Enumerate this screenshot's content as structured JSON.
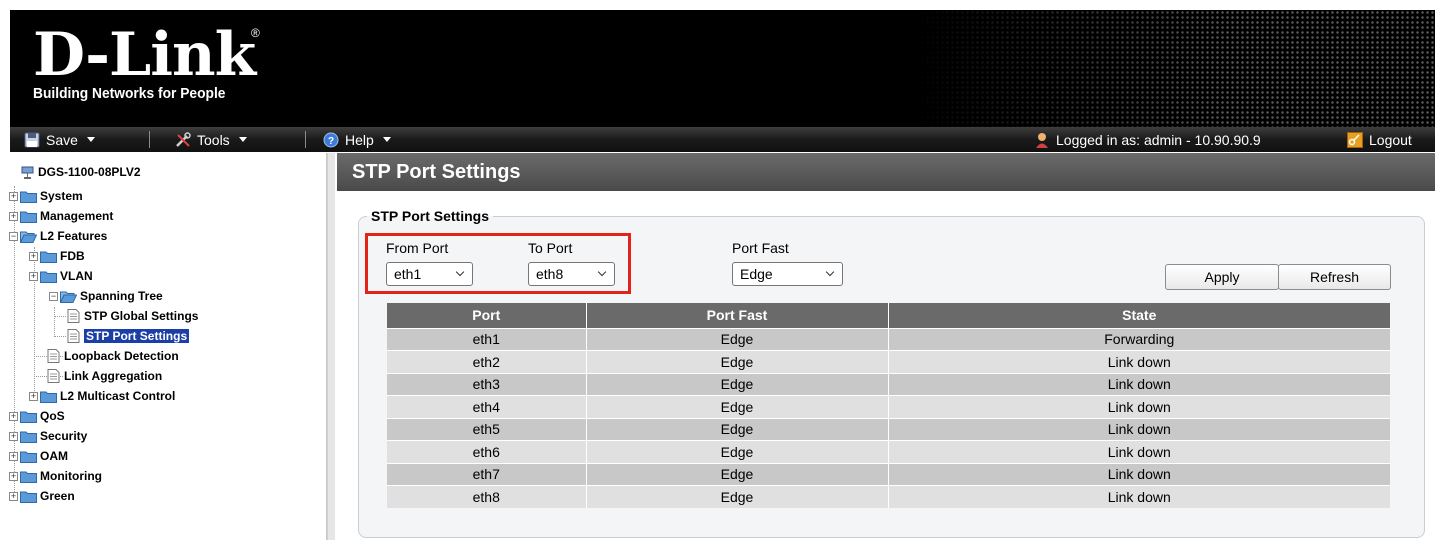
{
  "header": {
    "logo_main": "D-Link",
    "logo_tagline": "Building Networks for People",
    "logo_mark": "®"
  },
  "menubar": {
    "save_label": "Save",
    "tools_label": "Tools",
    "help_label": "Help",
    "logged_in_text": "Logged in as: admin - 10.90.90.9",
    "logout_label": "Logout"
  },
  "tree": {
    "root": "DGS-1100-08PLV2",
    "system": "System",
    "management": "Management",
    "l2_features": "L2 Features",
    "fdb": "FDB",
    "vlan": "VLAN",
    "spanning_tree": "Spanning Tree",
    "stp_global": "STP Global Settings",
    "stp_port": "STP Port Settings",
    "loopback": "Loopback Detection",
    "link_aggregation": "Link Aggregation",
    "l2_multicast": "L2 Multicast Control",
    "qos": "QoS",
    "security": "Security",
    "oam": "OAM",
    "monitoring": "Monitoring",
    "green": "Green"
  },
  "page": {
    "title": "STP Port Settings",
    "legend": "STP Port Settings"
  },
  "form": {
    "from_port_label": "From Port",
    "from_port_value": "eth1",
    "to_port_label": "To Port",
    "to_port_value": "eth8",
    "port_fast_label": "Port Fast",
    "port_fast_value": "Edge",
    "apply_label": "Apply",
    "refresh_label": "Refresh"
  },
  "table": {
    "headers": [
      "Port",
      "Port Fast",
      "State"
    ],
    "rows": [
      [
        "eth1",
        "Edge",
        "Forwarding"
      ],
      [
        "eth2",
        "Edge",
        "Link down"
      ],
      [
        "eth3",
        "Edge",
        "Link down"
      ],
      [
        "eth4",
        "Edge",
        "Link down"
      ],
      [
        "eth5",
        "Edge",
        "Link down"
      ],
      [
        "eth6",
        "Edge",
        "Link down"
      ],
      [
        "eth7",
        "Edge",
        "Link down"
      ],
      [
        "eth8",
        "Edge",
        "Link down"
      ]
    ]
  },
  "colors": {
    "accent_selected": "#1b3fa6",
    "highlight_box": "#e2231a",
    "table_header": "#6a6a6a"
  }
}
